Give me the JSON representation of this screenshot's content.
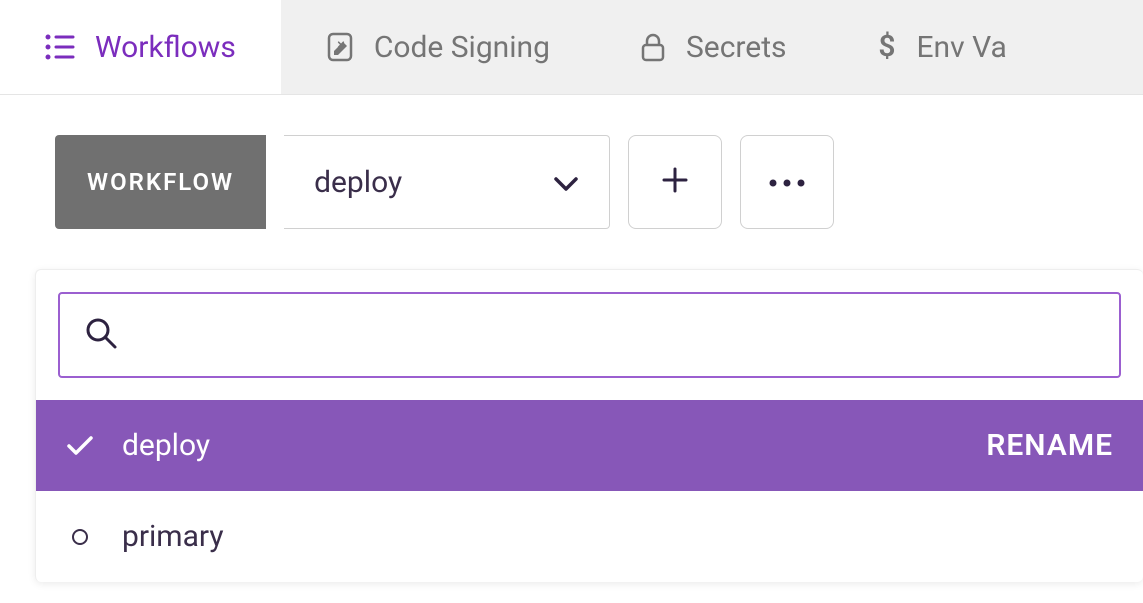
{
  "tabs": [
    {
      "label": "Workflows",
      "icon": "list-icon",
      "active": true
    },
    {
      "label": "Code Signing",
      "icon": "document-icon",
      "active": false
    },
    {
      "label": "Secrets",
      "icon": "lock-icon",
      "active": false
    },
    {
      "label": "Env Va",
      "icon": "dollar-icon",
      "active": false
    }
  ],
  "toolbar": {
    "workflow_label": "WORKFLOW",
    "workflow_selected": "deploy"
  },
  "dropdown": {
    "search_placeholder": "",
    "items": [
      {
        "label": "deploy",
        "selected": true,
        "action": "RENAME"
      },
      {
        "label": "primary",
        "selected": false,
        "action": ""
      }
    ]
  }
}
